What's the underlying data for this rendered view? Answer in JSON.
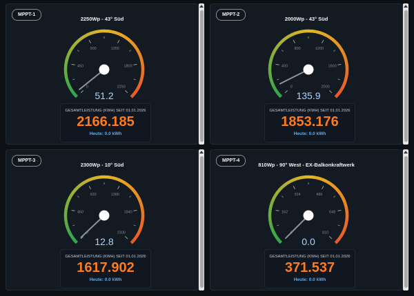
{
  "colors": {
    "background": "#0d1015",
    "card": "#141a22",
    "value_orange": "#ff7a1a",
    "today_blue": "#58aef0",
    "readout": "#aad4ff",
    "gauge_green": "#2fa84f",
    "gauge_yellow": "#e6b623",
    "gauge_red": "#e8542a"
  },
  "cards": [
    {
      "tag": "MPPT-1",
      "title": "2250Wp - 43° Süd",
      "gauge": {
        "min": 0,
        "max": 2250,
        "ticks": [
          "0",
          "450",
          "900",
          "1350",
          "1800",
          "2250"
        ],
        "value": 51.2,
        "value_text": "51.2"
      },
      "total_label": "GESAMTLEISTUNG (KWH) SEIT 01.01.2026",
      "total_value": "2166.185",
      "today": "Heute: 0.0 kWh"
    },
    {
      "tag": "MPPT-2",
      "title": "2000Wp - 43° Süd",
      "gauge": {
        "min": 0,
        "max": 2000,
        "ticks": [
          "0",
          "400",
          "800",
          "1200",
          "1600",
          "2000"
        ],
        "value": 135.9,
        "value_text": "135.9"
      },
      "total_label": "GESAMTLEISTUNG (KWH) SEIT 01.01.2026",
      "total_value": "1853.176",
      "today": "Heute: 0.0 kWh"
    },
    {
      "tag": "MPPT-3",
      "title": "2300Wp - 10° Süd",
      "gauge": {
        "min": 0,
        "max": 2300,
        "ticks": [
          "0",
          "460",
          "920",
          "1380",
          "1840",
          "2300"
        ],
        "value": 12.8,
        "value_text": "12.8"
      },
      "total_label": "GESAMTLEISTUNG (KWH) SEIT 01.01.2026",
      "total_value": "1617.902",
      "today": "Heute: 0.0 kWh"
    },
    {
      "tag": "MPPT-4",
      "title": "810Wp - 90° West - EX-Balkonkraftwerk",
      "gauge": {
        "min": 0,
        "max": 810,
        "ticks": [
          "0",
          "162",
          "324",
          "486",
          "648",
          "810"
        ],
        "value": 0.0,
        "value_text": "0.0"
      },
      "total_label": "GESAMTLEISTUNG (KWH) SEIT 01.01.2026",
      "total_value": "371.537",
      "today": "Heute: 0.0 kWh"
    }
  ]
}
